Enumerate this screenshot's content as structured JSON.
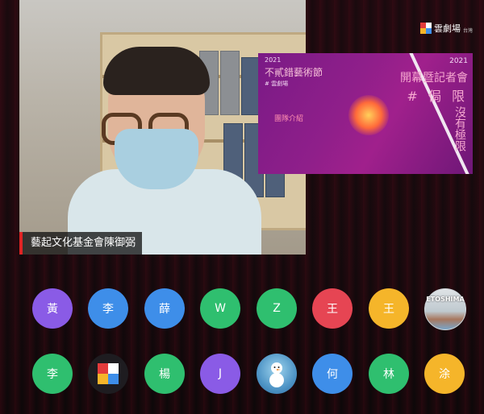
{
  "brand": {
    "name": "雲劇場",
    "small": "台灣"
  },
  "main_video": {
    "speaker_name": "藝起文化基金會陳御弼"
  },
  "shared_screen": {
    "year_left": "2021",
    "festival_title": "不貳錯藝術節",
    "subtitle": "# 雲劇場",
    "intro": "團隊介紹",
    "year_right": "2021",
    "event_title": "開幕暨記者會",
    "hashtag": "# 侷 限",
    "vertical_1": "沒有極限",
    "vertical_2": ""
  },
  "participants": [
    {
      "label": "黃",
      "color": "#8a5be6"
    },
    {
      "label": "李",
      "color": "#3e8ee9"
    },
    {
      "label": "薛",
      "color": "#3e8ee9"
    },
    {
      "label": "W",
      "color": "#2fbf6f"
    },
    {
      "label": "Z",
      "color": "#2fbf6f"
    },
    {
      "label": "王",
      "color": "#e64553"
    },
    {
      "label": "王",
      "color": "#f5b52a"
    },
    {
      "label": "ETOSHIMA",
      "color": ""
    },
    {
      "label": "李",
      "color": "#2fbf6f"
    },
    {
      "label": "",
      "color": ""
    },
    {
      "label": "楊",
      "color": "#2fbf6f"
    },
    {
      "label": "J",
      "color": "#8a5be6"
    },
    {
      "label": "",
      "color": ""
    },
    {
      "label": "何",
      "color": "#3e8ee9"
    },
    {
      "label": "林",
      "color": "#2fbf6f"
    },
    {
      "label": "涂",
      "color": "#f5b52a"
    }
  ]
}
